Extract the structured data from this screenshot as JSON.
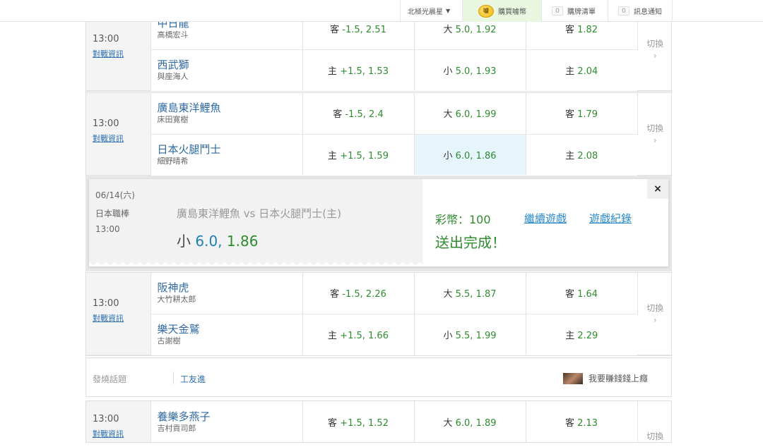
{
  "topbar": {
    "user": "北極光晨星",
    "buy": "購買噱幣",
    "coin_badge": "噱",
    "orders": "購牌清單",
    "orders_count": "0",
    "notify": "訊息通知",
    "notify_count": "0"
  },
  "common": {
    "time": "13:00",
    "info_link": "對戰資訊",
    "switch": "切換"
  },
  "matches": [
    {
      "away": {
        "team": "中日龍",
        "pitcher": "高橋宏斗",
        "spread": {
          "label": "客",
          "val": "-1.5, 2.51"
        },
        "total": {
          "label": "大",
          "val": "5.0, 1.92"
        },
        "ml": {
          "label": "客",
          "val": "1.82"
        }
      },
      "home": {
        "team": "西武獅",
        "pitcher": "與座海人",
        "spread": {
          "label": "主",
          "val": "+1.5, 1.53"
        },
        "total": {
          "label": "小",
          "val": "5.0, 1.93"
        },
        "ml": {
          "label": "主",
          "val": "2.04"
        }
      }
    },
    {
      "away": {
        "team": "廣島東洋鯉魚",
        "pitcher": "床田寛樹",
        "spread": {
          "label": "客",
          "val": "-1.5, 2.4"
        },
        "total": {
          "label": "大",
          "val": "6.0, 1.99"
        },
        "ml": {
          "label": "客",
          "val": "1.79"
        }
      },
      "home": {
        "team": "日本火腿鬥士",
        "pitcher": "細野晴希",
        "spread": {
          "label": "主",
          "val": "+1.5, 1.59"
        },
        "total": {
          "label": "小",
          "val": "6.0, 1.86"
        },
        "ml": {
          "label": "主",
          "val": "2.08"
        }
      }
    },
    {
      "away": {
        "team": "阪神虎",
        "pitcher": "大竹耕太郎",
        "spread": {
          "label": "客",
          "val": "-1.5, 2.26"
        },
        "total": {
          "label": "大",
          "val": "5.5, 1.87"
        },
        "ml": {
          "label": "客",
          "val": "1.64"
        }
      },
      "home": {
        "team": "樂天金鷲",
        "pitcher": "古謝樹",
        "spread": {
          "label": "主",
          "val": "+1.5, 1.66"
        },
        "total": {
          "label": "小",
          "val": "5.5, 1.99"
        },
        "ml": {
          "label": "主",
          "val": "2.29"
        }
      }
    },
    {
      "away": {
        "team": "養樂多燕子",
        "pitcher": "吉村貢司郎",
        "spread": {
          "label": "客",
          "val": "+1.5, 1.52"
        },
        "total": {
          "label": "大",
          "val": "6.0, 1.89"
        },
        "ml": {
          "label": "客",
          "val": "2.13"
        }
      }
    }
  ],
  "ticket": {
    "date": "06/14(六)",
    "league": "日本職棒",
    "time": "13:00",
    "matchup": "廣島東洋鯉魚  vs  日本火腿鬥士(主)",
    "bet_label": "小",
    "bet_num": "6.0,",
    "bet_odd": "1.86",
    "coins": "彩幣：100",
    "done": "送出完成！",
    "continue": "繼續遊戲",
    "history": "遊戲紀錄",
    "close": "×"
  },
  "forum": {
    "label": "發燒話題",
    "topic": "工友進",
    "promo": "我要賺錢錢上癮"
  }
}
